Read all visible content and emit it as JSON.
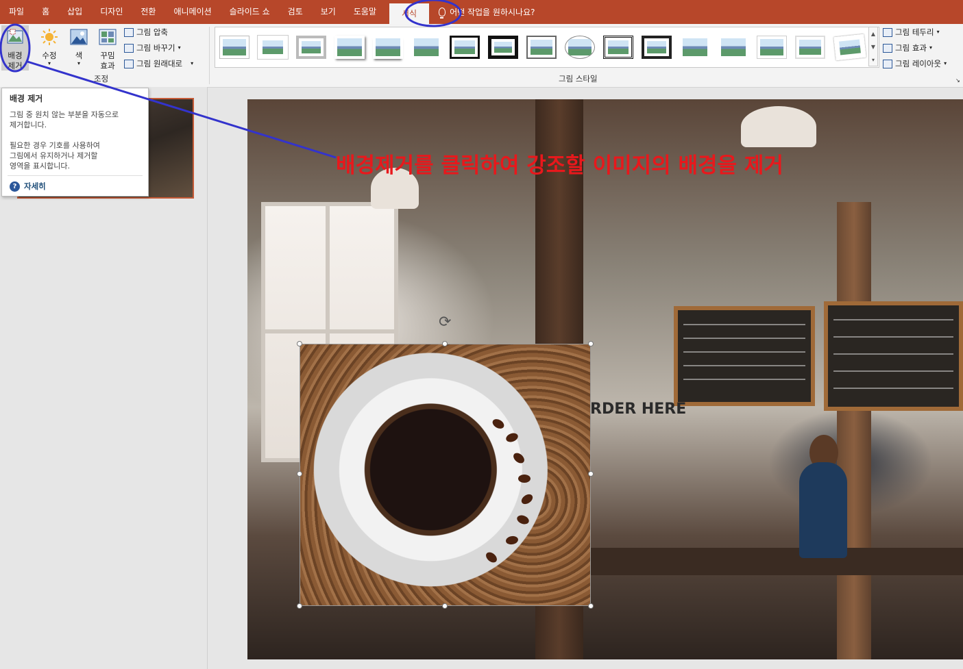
{
  "tabs": [
    "파일",
    "홈",
    "삽입",
    "디자인",
    "전환",
    "애니메이션",
    "슬라이드 쇼",
    "검토",
    "보기",
    "도움말",
    "서식"
  ],
  "active_tab_index": 10,
  "tell_me": "어떤 작업을 원하시나요?",
  "ribbon": {
    "adjust": {
      "remove_bg": "배경\n제거",
      "corrections": "수정",
      "color": "색",
      "artistic": "꾸밈\n효과",
      "compress": "그림 압축",
      "change": "그림 바꾸기",
      "reset": "그림 원래대로",
      "group_label": "조정"
    },
    "styles": {
      "group_label": "그림 스타일",
      "border": "그림 테두리",
      "effects": "그림 효과",
      "layout": "그림 레이아웃"
    }
  },
  "tooltip": {
    "title": "배경 제거",
    "lines": [
      "그림 중 원치 않는 부분을 자동으로",
      "제거합니다.",
      "",
      "필요한 경우 기호를 사용하여",
      "그림에서 유지하거나 제거할",
      "영역을 표시합니다."
    ],
    "help": "자세히"
  },
  "slide": {
    "annotation": "배경제거를 클릭하여 강조할 이미지의 배경을 제거",
    "sign": "RDER HERE"
  },
  "colors": {
    "tabbar": "#b7472a",
    "annotation": "#e8181c",
    "callout": "#3333cc"
  }
}
